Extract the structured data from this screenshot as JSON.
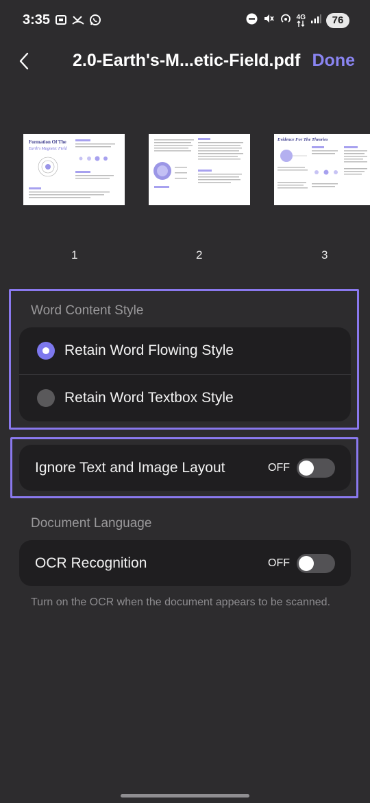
{
  "status_bar": {
    "time": "3:35",
    "network": "4G",
    "battery": "76",
    "left_icons": [
      "screenshot-icon",
      "call-missed-icon",
      "whatsapp-icon"
    ],
    "right_icons": [
      "do-not-disturb-icon",
      "mute-icon",
      "hotspot-icon",
      "data-arrows-icon",
      "signal-icon"
    ]
  },
  "header": {
    "title": "2.0-Earth's-M...etic-Field.pdf",
    "done_label": "Done"
  },
  "pages": [
    {
      "number": "1",
      "heading": "Formation Of The",
      "subheading": "Earth's Magnetic Field"
    },
    {
      "number": "2"
    },
    {
      "number": "3",
      "heading": "Evidence For The Theories"
    }
  ],
  "word_content_style": {
    "label": "Word Content Style",
    "options": [
      {
        "label": "Retain Word Flowing Style",
        "selected": true
      },
      {
        "label": "Retain Word Textbox Style",
        "selected": false
      }
    ]
  },
  "ignore_layout": {
    "label": "Ignore Text and Image Layout",
    "state": "OFF"
  },
  "document_language": {
    "label": "Document Language"
  },
  "ocr": {
    "label": "OCR Recognition",
    "state": "OFF",
    "hint": "Turn on the OCR when the document appears to be scanned."
  },
  "colors": {
    "accent": "#8a85f2",
    "highlight": "#8a79ee",
    "background": "#2d2c2e",
    "card": "#1f1e20"
  }
}
